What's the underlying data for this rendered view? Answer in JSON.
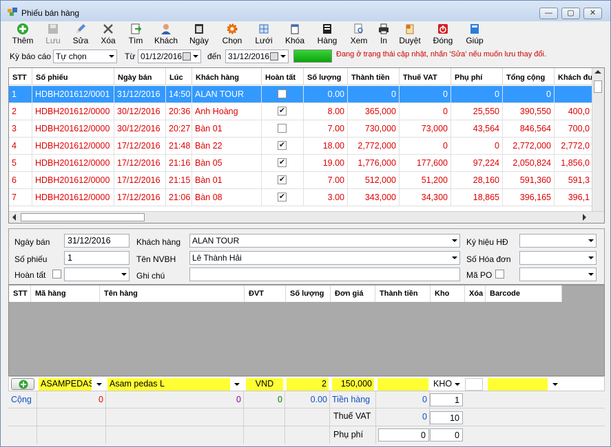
{
  "window": {
    "title": "Phiếu bán hàng",
    "min": "—",
    "max": "▢",
    "close": "✕"
  },
  "toolbar": [
    {
      "label": "Thêm",
      "icon": "add-icon",
      "enabled": true
    },
    {
      "label": "Lưu",
      "icon": "save-icon",
      "enabled": false
    },
    {
      "label": "Sửa",
      "icon": "edit-icon",
      "enabled": true
    },
    {
      "label": "Xóa",
      "icon": "delete-icon",
      "enabled": true
    },
    {
      "label": "Tìm",
      "icon": "find-icon",
      "enabled": true
    },
    {
      "label": "Khách",
      "icon": "customer-icon",
      "enabled": true
    },
    {
      "label": "Ngày",
      "icon": "date-icon",
      "enabled": true
    },
    {
      "label": "Chọn",
      "icon": "select-gear-icon",
      "enabled": true
    },
    {
      "label": "Lưới",
      "icon": "grid-icon",
      "enabled": true
    },
    {
      "label": "Khóa",
      "icon": "lock-icon",
      "enabled": true
    },
    {
      "label": "Hàng",
      "icon": "goods-icon",
      "enabled": true
    },
    {
      "label": "Xem",
      "icon": "preview-icon",
      "enabled": true
    },
    {
      "label": "In",
      "icon": "print-icon",
      "enabled": true
    },
    {
      "label": "Duyệt",
      "icon": "approve-icon",
      "enabled": true
    },
    {
      "label": "Đóng",
      "icon": "power-icon",
      "enabled": true
    },
    {
      "label": "Giúp",
      "icon": "help-book-icon",
      "enabled": true
    }
  ],
  "filter": {
    "period_label": "Kỳ báo cáo",
    "period_value": "Tự chọn",
    "from_label": "Từ",
    "from_value": "01/12/2016",
    "to_label": "đến",
    "to_value": "31/12/2016",
    "status_message": "Đang ở trạng thái cập nhật, nhấn 'Sửa' nếu muốn lưu thay đổi."
  },
  "invoices": {
    "columns": [
      "STT",
      "Số phiếu",
      "Ngày bán",
      "Lúc",
      "Khách hàng",
      "Hoàn tất",
      "Số lượng",
      "Thành tiền",
      "Thuế VAT",
      "Phụ phí",
      "Tổng cộng",
      "Khách đưa"
    ],
    "rows": [
      {
        "stt": "1",
        "so_phieu": "HDBH201612/0001",
        "ngay": "31/12/2016",
        "luc": "14:50",
        "khach": "ALAN TOUR",
        "done": false,
        "sl": "0.00",
        "thanh_tien": "0",
        "vat": "0",
        "phu_phi": "0",
        "tong": "0",
        "dua": ""
      },
      {
        "stt": "2",
        "so_phieu": "HDBH201612/0000",
        "ngay": "30/12/2016",
        "luc": "20:36",
        "khach": "Anh Hoàng",
        "done": true,
        "sl": "8.00",
        "thanh_tien": "365,000",
        "vat": "0",
        "phu_phi": "25,550",
        "tong": "390,550",
        "dua": "400,0"
      },
      {
        "stt": "3",
        "so_phieu": "HDBH201612/0000",
        "ngay": "30/12/2016",
        "luc": "20:27",
        "khach": "Bàn 01",
        "done": false,
        "sl": "7.00",
        "thanh_tien": "730,000",
        "vat": "73,000",
        "phu_phi": "43,564",
        "tong": "846,564",
        "dua": "700,0"
      },
      {
        "stt": "4",
        "so_phieu": "HDBH201612/0000",
        "ngay": "17/12/2016",
        "luc": "21:48",
        "khach": "Bàn 22",
        "done": true,
        "sl": "18.00",
        "thanh_tien": "2,772,000",
        "vat": "0",
        "phu_phi": "0",
        "tong": "2,772,000",
        "dua": "2,772,0"
      },
      {
        "stt": "5",
        "so_phieu": "HDBH201612/0000",
        "ngay": "17/12/2016",
        "luc": "21:16",
        "khach": "Bàn 05",
        "done": true,
        "sl": "19.00",
        "thanh_tien": "1,776,000",
        "vat": "177,600",
        "phu_phi": "97,224",
        "tong": "2,050,824",
        "dua": "1,856,0"
      },
      {
        "stt": "6",
        "so_phieu": "HDBH201612/0000",
        "ngay": "17/12/2016",
        "luc": "21:15",
        "khach": "Bàn 01",
        "done": true,
        "sl": "7.00",
        "thanh_tien": "512,000",
        "vat": "51,200",
        "phu_phi": "28,160",
        "tong": "591,360",
        "dua": "591,3"
      },
      {
        "stt": "7",
        "so_phieu": "HDBH201612/0000",
        "ngay": "17/12/2016",
        "luc": "21:06",
        "khach": "Bàn 08",
        "done": true,
        "sl": "3.00",
        "thanh_tien": "343,000",
        "vat": "34,300",
        "phu_phi": "18,865",
        "tong": "396,165",
        "dua": "396,1"
      }
    ]
  },
  "form": {
    "ngay_ban_label": "Ngày bán",
    "ngay_ban": "31/12/2016",
    "so_phieu_label": "Số phiếu",
    "so_phieu": "1",
    "hoan_tat_label": "Hoàn tất",
    "khach_hang_label": "Khách hàng",
    "khach_hang": "ALAN TOUR",
    "nvbh_label": "Tên NVBH",
    "nvbh": "Lê Thành Hải",
    "ghi_chu_label": "Ghi chú",
    "ghi_chu": "",
    "ky_hieu_label": "Ký hiệu HĐ",
    "so_hoa_don_label": "Số Hóa đơn",
    "ma_po_label": "Mã PO"
  },
  "items": {
    "columns": [
      "STT",
      "Mã hàng",
      "Tên hàng",
      "ĐVT",
      "Số lượng",
      "Đơn giá",
      "Thành tiền",
      "Kho",
      "Xóa",
      "Barcode"
    ]
  },
  "entry": {
    "ma_hang": "ASAMPEDASL",
    "ten_hang": "Asam pedas L",
    "dvt": "VND",
    "so_luong": "2",
    "don_gia": "150,000",
    "kho": "KHO"
  },
  "totals": {
    "cong_label": "Cộng",
    "cong_stt": "0",
    "cong_ten": "0",
    "cong_dvt": "0",
    "cong_sl": "0.00",
    "tien_hang_label": "Tiền hàng",
    "tien_hang": "0",
    "tien_hang_qty": "1",
    "thue_vat_label": "Thuế VAT",
    "thue_vat": "0",
    "thue_vat_pct": "10",
    "phu_phi_label": "Phụ phí",
    "phu_phi": "0",
    "phu_phi_pct": "0"
  }
}
